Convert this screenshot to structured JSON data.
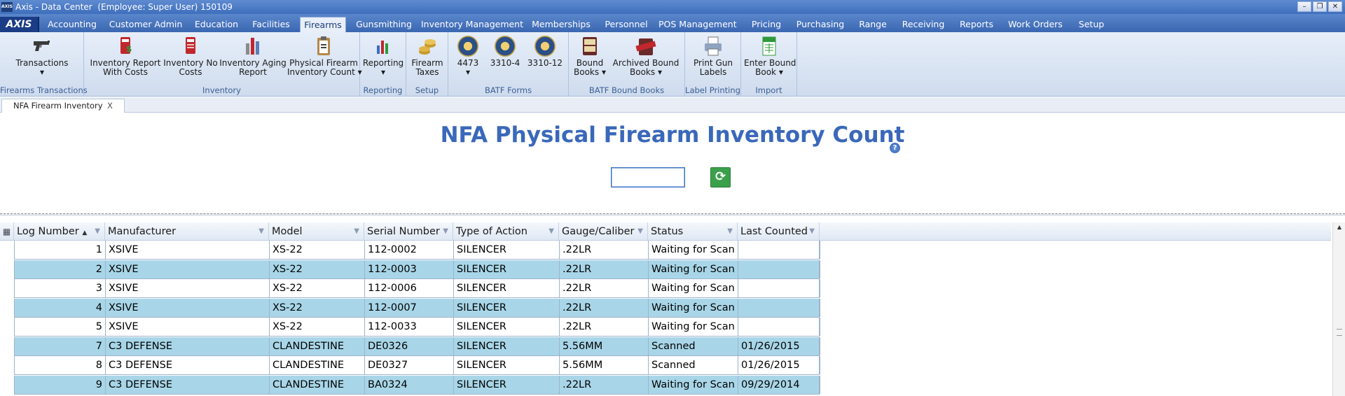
{
  "window": {
    "title": "Axis - Data Center  (Employee: Super User) 150109",
    "app_icon": "AXIS",
    "controls": [
      "minimize-icon",
      "restore-icon",
      "close-icon"
    ]
  },
  "menu": {
    "logo": "AXIS",
    "tabs": [
      {
        "label": "Accounting"
      },
      {
        "label": "Customer Admin"
      },
      {
        "label": "Education"
      },
      {
        "label": "Facilities"
      },
      {
        "label": "Firearms",
        "active": true
      },
      {
        "label": "Gunsmithing"
      },
      {
        "label": "Inventory Management"
      },
      {
        "label": "Memberships"
      },
      {
        "label": "Personnel"
      },
      {
        "label": "POS Management"
      },
      {
        "label": "Pricing"
      },
      {
        "label": "Purchasing"
      },
      {
        "label": "Range"
      },
      {
        "label": "Receiving"
      },
      {
        "label": "Reports"
      },
      {
        "label": "Work Orders"
      },
      {
        "label": "Setup"
      }
    ]
  },
  "ribbon": {
    "groups": [
      {
        "label": "Firearms Transactions",
        "buttons": [
          {
            "line1": "Transactions",
            "line2": "▾",
            "icon": "pistol-icon"
          }
        ]
      },
      {
        "label": "Inventory",
        "buttons": [
          {
            "line1": "Inventory Report",
            "line2": "With Costs",
            "icon": "report-costs-icon"
          },
          {
            "line1": "Inventory No",
            "line2": "Costs",
            "icon": "report-nocost-icon"
          },
          {
            "line1": "Inventory Aging",
            "line2": "Report",
            "icon": "aging-chart-icon"
          },
          {
            "line1": "Physical Firearm",
            "line2": "Inventory Count ▾",
            "icon": "clipboard-icon"
          }
        ]
      },
      {
        "label": "Reporting",
        "buttons": [
          {
            "line1": "Reporting",
            "line2": "▾",
            "icon": "bar-chart-icon"
          }
        ]
      },
      {
        "label": "Setup",
        "buttons": [
          {
            "line1": "Firearm",
            "line2": "Taxes",
            "icon": "coins-icon"
          }
        ]
      },
      {
        "label": "BATF Forms",
        "buttons": [
          {
            "line1": "4473",
            "line2": "▾",
            "icon": "batf-seal-icon"
          },
          {
            "line1": "3310-4",
            "line2": "",
            "icon": "batf-seal-icon"
          },
          {
            "line1": "3310-12",
            "line2": "",
            "icon": "batf-seal-icon"
          }
        ]
      },
      {
        "label": "BATF Bound Books",
        "buttons": [
          {
            "line1": "Bound",
            "line2": "Books ▾",
            "icon": "bound-book-icon"
          },
          {
            "line1": "Archived Bound",
            "line2": "Books ▾",
            "icon": "archived-stamp-icon"
          }
        ]
      },
      {
        "label": "Label Printing",
        "buttons": [
          {
            "line1": "Print Gun",
            "line2": "Labels",
            "icon": "printer-icon"
          }
        ]
      },
      {
        "label": "Import",
        "buttons": [
          {
            "line1": "Enter Bound",
            "line2": "Book ▾",
            "icon": "excel-import-icon"
          }
        ]
      }
    ]
  },
  "doc_tab": {
    "label": "NFA Firearm Inventory",
    "close": "X"
  },
  "page": {
    "title": "NFA Physical Firearm Inventory Count",
    "help": "?",
    "scan_input_value": "",
    "refresh_icon": "refresh-icon"
  },
  "grid": {
    "corner_icon": "column-chooser-icon",
    "sort_indicator": "▲",
    "filter_icon": "funnel-icon",
    "columns": [
      "Log Number",
      "Manufacturer",
      "Model",
      "Serial Number",
      "Type of Action",
      "Gauge/Caliber",
      "Status",
      "Last Counted"
    ],
    "rows": [
      [
        "1",
        "XSIVE",
        "XS-22",
        "112-0002",
        "SILENCER",
        ".22LR",
        "Waiting for Scan",
        ""
      ],
      [
        "2",
        "XSIVE",
        "XS-22",
        "112-0003",
        "SILENCER",
        ".22LR",
        "Waiting for Scan",
        ""
      ],
      [
        "3",
        "XSIVE",
        "XS-22",
        "112-0006",
        "SILENCER",
        ".22LR",
        "Waiting for Scan",
        ""
      ],
      [
        "4",
        "XSIVE",
        "XS-22",
        "112-0007",
        "SILENCER",
        ".22LR",
        "Waiting for Scan",
        ""
      ],
      [
        "5",
        "XSIVE",
        "XS-22",
        "112-0033",
        "SILENCER",
        ".22LR",
        "Waiting for Scan",
        ""
      ],
      [
        "7",
        "C3 DEFENSE",
        "CLANDESTINE",
        "DE0326",
        "SILENCER",
        "5.56MM",
        "Scanned",
        "01/26/2015"
      ],
      [
        "8",
        "C3 DEFENSE",
        "CLANDESTINE",
        "DE0327",
        "SILENCER",
        "5.56MM",
        "Scanned",
        "01/26/2015"
      ],
      [
        "9",
        "C3 DEFENSE",
        "CLANDESTINE",
        "BA0324",
        "SILENCER",
        ".22LR",
        "Waiting for Scan",
        "09/29/2014"
      ]
    ]
  },
  "colors": {
    "title_blue": "#3a68ba",
    "row_alt": "#a8d6e8",
    "refresh_green": "#3aa04a"
  }
}
